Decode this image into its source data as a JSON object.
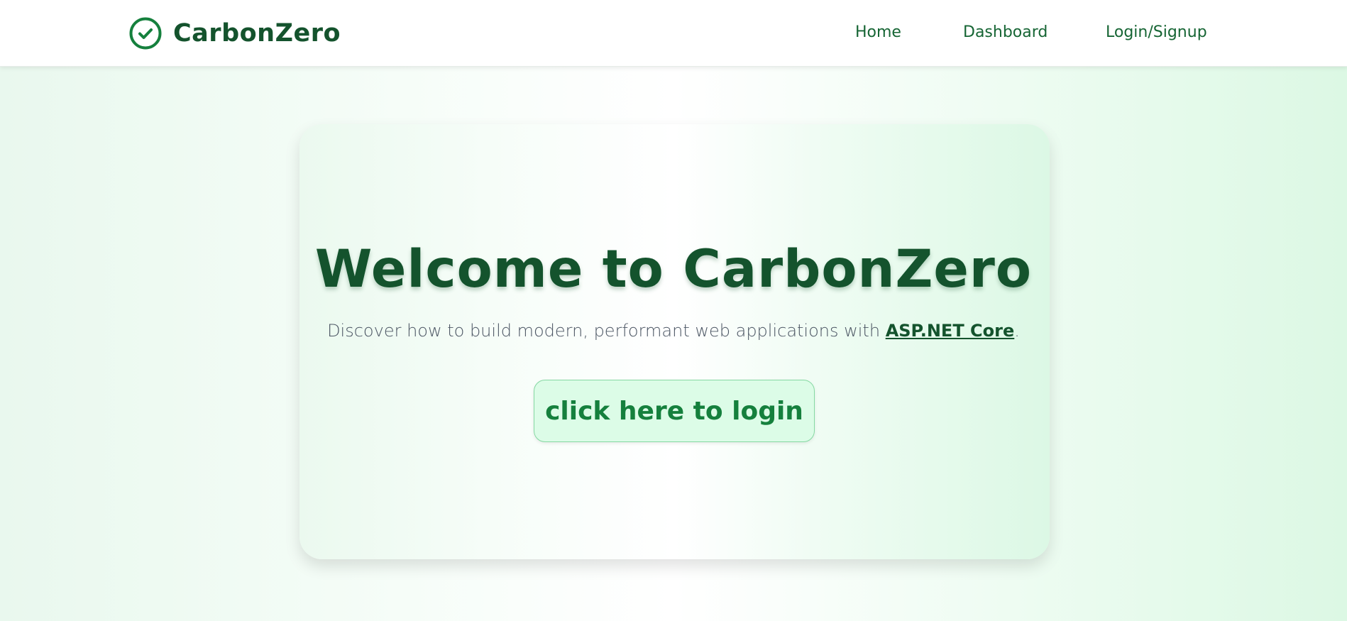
{
  "navbar": {
    "brand": {
      "name": "CarbonZero",
      "icon": "check-circle-icon"
    },
    "links": {
      "home": "Home",
      "dashboard": "Dashboard",
      "login": "Login/Signup"
    }
  },
  "hero": {
    "title": "Welcome to CarbonZero",
    "subtitle_prefix": "Discover how to build modern, performant web applications with ",
    "subtitle_link": "ASP.NET Core",
    "subtitle_suffix": ".",
    "button_label": "click here to login"
  },
  "colors": {
    "brand_dark_green": "#14532d",
    "accent_green": "#15803d",
    "button_background": "#dcfce7",
    "text_gray": "#4b5563"
  }
}
